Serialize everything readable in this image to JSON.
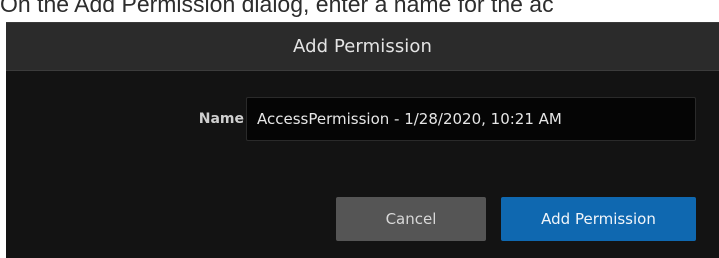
{
  "instruction_text": "On the Add Permission dialog, enter a name for the ac",
  "dialog": {
    "title": "Add Permission",
    "name_field": {
      "label": "Name",
      "required_marker": "*",
      "value": "AccessPermission - 1/28/2020, 10:21 AM"
    },
    "buttons": {
      "cancel_label": "Cancel",
      "submit_label": "Add Permission"
    }
  },
  "colors": {
    "dialog_background": "#131313",
    "header_background": "#2b2b2b",
    "required_marker": "#1f8fd8",
    "primary_button": "#0f68b0",
    "secondary_button": "#555555"
  }
}
